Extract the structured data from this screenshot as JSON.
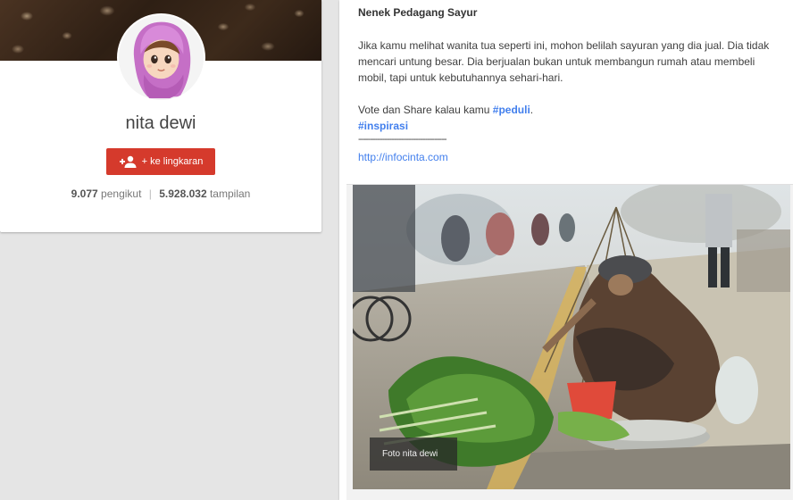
{
  "profile": {
    "name": "nita dewi",
    "add_circle_label": "+ ke lingkaran",
    "followers_count": "9.077",
    "followers_label": "pengikut",
    "separator": "|",
    "views_count": "5.928.032",
    "views_label": "tampilan"
  },
  "post": {
    "title": "Nenek Pedagang Sayur",
    "paragraph": "Jika kamu melihat wanita tua seperti ini, mohon belilah sayuran yang dia jual. Dia tidak mencari untung besar. Dia berjualan bukan untuk membangun rumah atau membeli mobil, tapi untuk kebutuhannya sehari-hari.",
    "vote_text": "Vote dan Share kalau kamu",
    "hashtag_peduli": "#peduli",
    "period": ".",
    "hashtag_inspirasi": "#inspirasi",
    "divider": "-------------------------------------",
    "link": "http://infocinta.com",
    "photo_caption": "Foto nita dewi"
  },
  "icons": {
    "add_person": "add-person-icon",
    "avatar": "hijab-girl-avatar"
  },
  "colors": {
    "button_red": "#d53a2c",
    "link_blue": "#427fed",
    "background": "#e5e5e5"
  }
}
